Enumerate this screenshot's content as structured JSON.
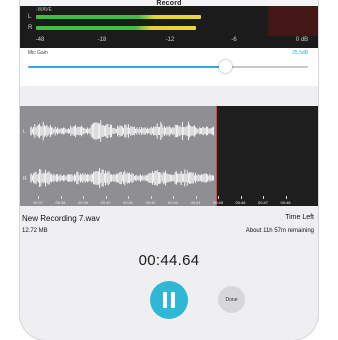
{
  "app": {
    "title": "Record"
  },
  "meter": {
    "tag": "-WAVE",
    "channels": [
      {
        "label": "L",
        "level": 0.71
      },
      {
        "label": "R",
        "level": 0.69
      }
    ],
    "scale": [
      "-48",
      "-18",
      "-12",
      "-6",
      "0 dB"
    ]
  },
  "mic_gain": {
    "label": "Mic Gain",
    "value": "25.5dB",
    "level": 0.7
  },
  "waveform": {
    "channels": [
      "L",
      "R"
    ],
    "timeline": [
      "00:37",
      "00:38",
      "00:39",
      "00:40",
      "00:41",
      "00:42",
      "00:43",
      "00:44",
      "00:45",
      "00:46",
      "00:47",
      "00:48"
    ]
  },
  "recording": {
    "file_name": "New Recording 7.wav",
    "file_size": "12.72 MB",
    "time_left_label": "Time Left",
    "time_left_value": "About 11h 57m remaining",
    "elapsed": "00:44.64"
  },
  "controls": {
    "done_label": "Done",
    "pause_icon": "pause-icon"
  },
  "colors": {
    "accent": "#34aadc",
    "record_button": "#2fb8d6",
    "playhead": "#ff3b30"
  }
}
